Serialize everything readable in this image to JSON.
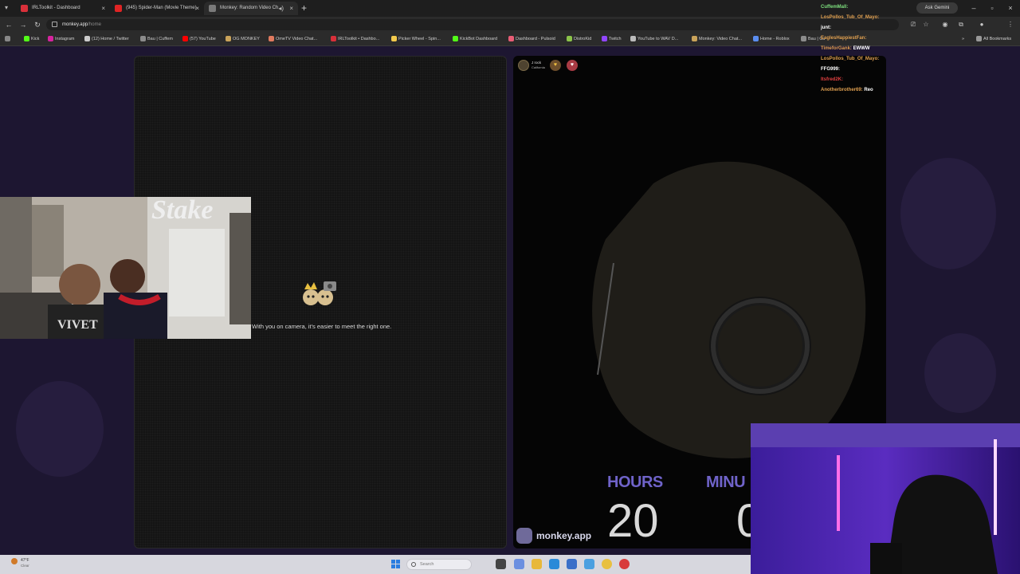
{
  "browser": {
    "tabs": [
      {
        "title": "IRLToolkit - Dashboard",
        "color": "#d9303a",
        "active": false
      },
      {
        "title": "(945) Spider-Man (Movie Theme)",
        "color": "#e02424",
        "active": false
      },
      {
        "title": "Monkey: Random Video Ch",
        "color": "#7a7a7a",
        "active": true
      }
    ],
    "url_host": "monkey.app",
    "url_path": "/home",
    "ask_gemini": "Ask Gemini",
    "all_bookmarks": "All Bookmarks",
    "bookmarks": [
      {
        "label": "Kick",
        "color": "#53fc18"
      },
      {
        "label": "Instagram",
        "color": "#d6249f"
      },
      {
        "label": "(12) Home / Twitter",
        "color": "#cccccc"
      },
      {
        "label": "Bau | Cuffem",
        "color": "#8c8c8c"
      },
      {
        "label": "(57) YouTube",
        "color": "#ff0000"
      },
      {
        "label": "OG MONKEY",
        "color": "#c9a35a"
      },
      {
        "label": "OmeTV Video Chat...",
        "color": "#e07a5f"
      },
      {
        "label": "IRLToolkit • Dashbo...",
        "color": "#d9303a"
      },
      {
        "label": "Picker Wheel - Spin...",
        "color": "#f2c94c"
      },
      {
        "label": "KickBot Dashboard",
        "color": "#53fc18"
      },
      {
        "label": "Dashboard - Pulsoid",
        "color": "#e85d75"
      },
      {
        "label": "DistroKid",
        "color": "#8bc34a"
      },
      {
        "label": "Twitch",
        "color": "#9146ff"
      },
      {
        "label": "YouTube to WAV D...",
        "color": "#bbbbbb"
      },
      {
        "label": "Monkey: Video Chat...",
        "color": "#c9a35a"
      },
      {
        "label": "Home - Roblox",
        "color": "#5b8def"
      },
      {
        "label": "Bau | Cu",
        "color": "#8c8c8c"
      }
    ]
  },
  "left_panel": {
    "camera_message": "With you on camera, it's easier to meet the right one."
  },
  "right_panel": {
    "peer_name": "J rock",
    "peer_location": "California",
    "brand": "monkey.app"
  },
  "timer": {
    "hours_label": "HOURS",
    "hours_value": "20",
    "minutes_label": "MINU",
    "minutes_value": "0"
  },
  "facecam": {
    "sponsor": "Stake",
    "shirt_text": "VIVET"
  },
  "chat": [
    {
      "user": "CuffemMall:",
      "message": "",
      "color": "#7ee07e"
    },
    {
      "user": "LosPollos_Tub_Of_Mayo:",
      "message": "",
      "color": "#e0a050"
    },
    {
      "user": "junt:",
      "message": "",
      "color": "#ffffff"
    },
    {
      "user": "EaglesHappiestFan:",
      "message": "",
      "color": "#e0a050"
    },
    {
      "user": "TimeforGank:",
      "message": "EWWW",
      "color": "#e0a050"
    },
    {
      "user": "LosPollos_Tub_Of_Mayo:",
      "message": "",
      "color": "#e0a050"
    },
    {
      "user": "FFG999:",
      "message": "",
      "color": "#ffffff"
    },
    {
      "user": "Itsfred2K:",
      "message": "",
      "color": "#e04040"
    },
    {
      "user": "Anotherbrother69:",
      "message": "Reo",
      "color": "#e0a050"
    }
  ],
  "taskbar": {
    "weather_temp": "47°F",
    "weather_desc": "Clear",
    "search_placeholder": "Search"
  },
  "colors": {
    "accent_purple": "#6f63c9",
    "page_bg": "#1d1631"
  }
}
